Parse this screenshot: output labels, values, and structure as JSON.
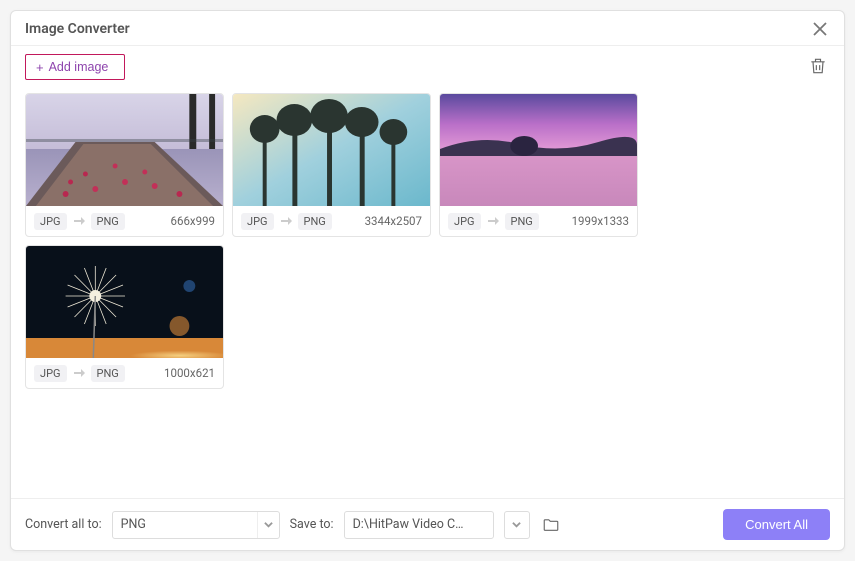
{
  "header": {
    "title": "Image Converter"
  },
  "toolbar": {
    "add_image_label": "Add image"
  },
  "images": [
    {
      "from": "JPG",
      "to": "PNG",
      "dims": "666x999"
    },
    {
      "from": "JPG",
      "to": "PNG",
      "dims": "3344x2507"
    },
    {
      "from": "JPG",
      "to": "PNG",
      "dims": "1999x1333"
    },
    {
      "from": "JPG",
      "to": "PNG",
      "dims": "1000x621"
    }
  ],
  "footer": {
    "convert_all_to_label": "Convert all to:",
    "format_value": "PNG",
    "save_to_label": "Save to:",
    "save_to_value": "D:\\HitPaw Video Conve...",
    "convert_all_button": "Convert All"
  }
}
